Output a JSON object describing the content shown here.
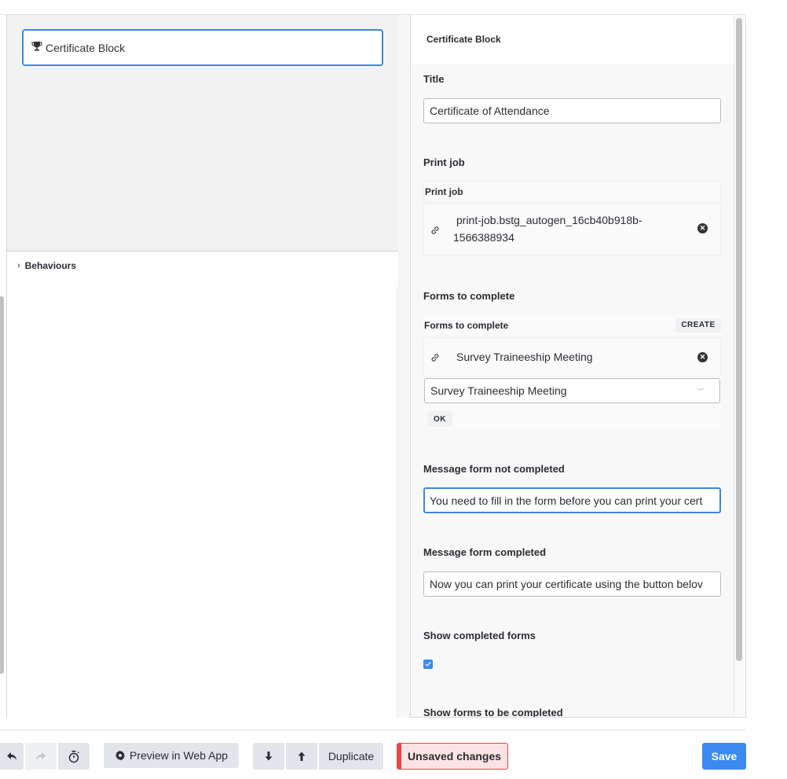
{
  "canvas": {
    "block": {
      "icon": "trophy-icon",
      "label": "Certificate Block"
    },
    "behaviours": {
      "icon": "chevron-right-icon",
      "label": "Behaviours"
    }
  },
  "panel": {
    "title": "Certificate Block",
    "fields": {
      "title": {
        "label": "Title",
        "value": "Certificate of Attendance"
      },
      "print_job": {
        "label": "Print job",
        "box_header": "Print job",
        "item": {
          "icon": "link-icon",
          "line1": "print-job.bstg_autogen_16cb40b918b-",
          "line2": "1566388934",
          "remove_icon": "remove-circle-icon"
        }
      },
      "forms_to_complete": {
        "label": "Forms to complete",
        "box_header": "Forms to complete",
        "create_label": "CREATE",
        "item": {
          "icon": "link-icon",
          "text": "Survey Traineeship Meeting",
          "remove_icon": "remove-circle-icon"
        },
        "select_value": "Survey Traineeship Meeting",
        "ok_label": "OK"
      },
      "message_not_completed": {
        "label": "Message form not completed",
        "value": "You need to fill in the form before you can print your cert"
      },
      "message_completed": {
        "label": "Message form completed",
        "value": "Now you can print your certificate using the button belov"
      },
      "show_completed_forms": {
        "label": "Show completed forms",
        "checked": true
      },
      "show_forms_to_be_completed": {
        "label": "Show forms to be completed"
      }
    }
  },
  "toolbar": {
    "undo_icon": "undo-icon",
    "redo_icon": "redo-icon",
    "timer_icon": "stopwatch-icon",
    "preview_label": "Preview in Web App",
    "preview_icon": "gear-icon",
    "move_down_icon": "arrow-down-icon",
    "move_up_icon": "arrow-up-icon",
    "duplicate_label": "Duplicate",
    "unsaved_label": "Unsaved changes",
    "save_label": "Save"
  },
  "colors": {
    "accent": "#3b8af0",
    "focus_border": "#3f86e0",
    "unsaved_bg": "#fde3e3",
    "unsaved_border": "#ef4444"
  }
}
